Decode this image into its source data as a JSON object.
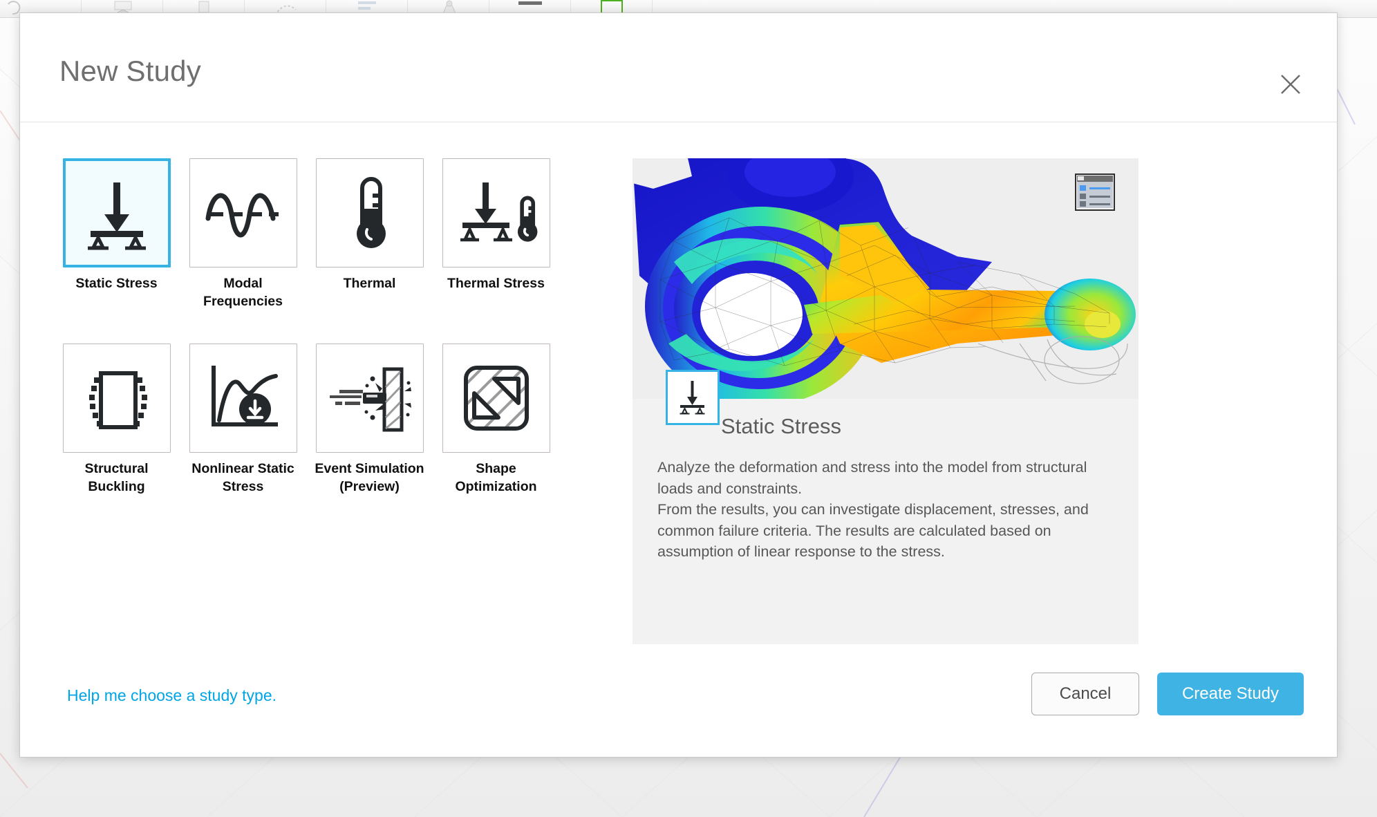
{
  "dialog": {
    "title": "New Study",
    "close_icon": "close-icon"
  },
  "study_types": [
    {
      "id": "static-stress",
      "label": "Static Stress",
      "icon": "beam-load-icon",
      "selected": true
    },
    {
      "id": "modal-frequencies",
      "label": "Modal Frequencies",
      "icon": "sine-wave-icon",
      "selected": false
    },
    {
      "id": "thermal",
      "label": "Thermal",
      "icon": "thermometer-icon",
      "selected": false
    },
    {
      "id": "thermal-stress",
      "label": "Thermal Stress",
      "icon": "beam-thermometer-icon",
      "selected": false
    },
    {
      "id": "structural-buckling",
      "label": "Structural Buckling",
      "icon": "buckling-column-icon",
      "selected": false
    },
    {
      "id": "nonlinear-static-stress",
      "label": "Nonlinear Static\nStress",
      "icon": "nonlinear-curve-icon",
      "selected": false
    },
    {
      "id": "event-simulation",
      "label": "Event Simulation\n(Preview)",
      "icon": "impact-icon",
      "selected": false
    },
    {
      "id": "shape-optimization",
      "label": "Shape Optimization",
      "icon": "shape-optimization-icon",
      "selected": false
    }
  ],
  "preview": {
    "image_alt": "Static stress FEA result of a steering knuckle with rainbow stress contours",
    "viewcube_icon": "display-options-icon",
    "selected_icon": "beam-load-icon",
    "selected_name": "Static Stress",
    "description": "Analyze the deformation and stress into the model from structural loads and constraints.\nFrom the results, you can investigate displacement, stresses, and common failure criteria. The results are calculated based on assumption of linear response to the stress."
  },
  "footer": {
    "help_link": "Help me choose a study type.",
    "cancel_label": "Cancel",
    "create_label": "Create Study"
  },
  "colors": {
    "accent": "#34b3e4",
    "link": "#00a5e5",
    "primary_button": "#3fb3e3",
    "selected_tile_fill": "#f2fbfe",
    "title_text": "#6f6f6f"
  }
}
